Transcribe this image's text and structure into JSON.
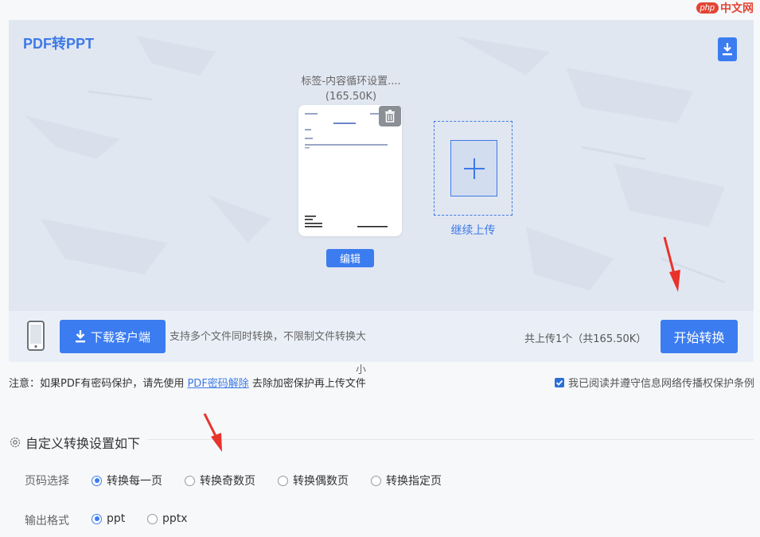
{
  "watermark": {
    "badge": "php",
    "text": "中文网"
  },
  "panel": {
    "title": "PDF转PPT",
    "file": {
      "name": "标签-内容循环设置....",
      "size": "(165.50K)"
    },
    "edit_label": "编辑",
    "add_label": "继续上传"
  },
  "toolbar": {
    "client_label": "下载客户端",
    "support_text_1": "支持多个文件同时转换，不限制文件转换大",
    "support_text_2": "小",
    "count_text": "共上传1个（共165.50K）",
    "start_label": "开始转换"
  },
  "notice": {
    "prefix": "注意：如果PDF有密码保护，请先使用 ",
    "link": "PDF密码解除",
    "suffix": " 去除加密保护再上传文件"
  },
  "agreement": {
    "label": "我已阅读并遵守信息网络传播权保护条例",
    "checked": true
  },
  "settings": {
    "heading": "自定义转换设置如下",
    "page": {
      "label": "页码选择",
      "options": [
        "转换每一页",
        "转换奇数页",
        "转换偶数页",
        "转换指定页"
      ],
      "selected": "转换每一页"
    },
    "format": {
      "label": "输出格式",
      "options": [
        "ppt",
        "pptx"
      ],
      "selected": "ppt"
    }
  },
  "colors": {
    "accent": "#3b7cf0",
    "arrow": "#e8332b",
    "panel_bg": "#e1e7f1"
  }
}
